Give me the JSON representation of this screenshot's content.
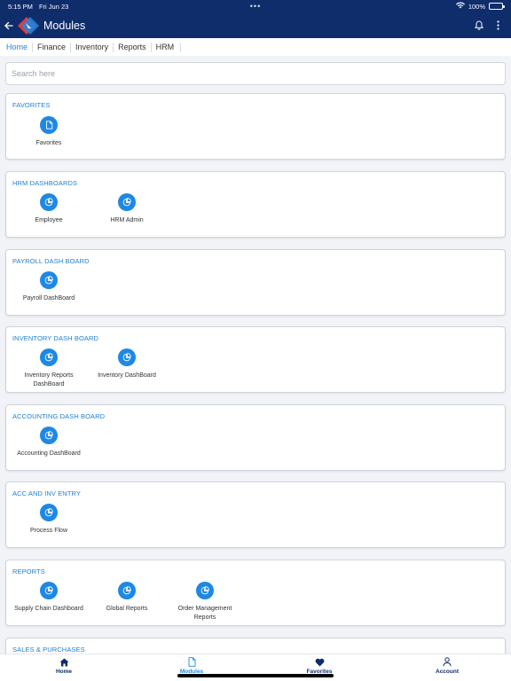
{
  "status": {
    "time": "5:15 PM",
    "date": "Fri Jun 23",
    "dots": "•••",
    "battery": "100%"
  },
  "header": {
    "title": "Modules"
  },
  "tabs": [
    {
      "label": "Home",
      "active": true
    },
    {
      "label": "Finance"
    },
    {
      "label": "Inventory"
    },
    {
      "label": "Reports"
    },
    {
      "label": "HRM"
    }
  ],
  "search": {
    "placeholder": "Search here",
    "value": ""
  },
  "sections": [
    {
      "title": "FAVORITES",
      "items": [
        {
          "label": "Favorites",
          "icon": "document-icon"
        }
      ]
    },
    {
      "title": "HRM DASHBOARDS",
      "items": [
        {
          "label": "Employee",
          "icon": "pie-chart-icon"
        },
        {
          "label": "HRM Admin",
          "icon": "pie-chart-icon"
        }
      ]
    },
    {
      "title": "PAYROLL DASH BOARD",
      "items": [
        {
          "label": "Payroll DashBoard",
          "icon": "pie-chart-icon"
        }
      ]
    },
    {
      "title": "INVENTORY DASH BOARD",
      "items": [
        {
          "label": "Inventory Reports DashBoard",
          "icon": "pie-chart-icon"
        },
        {
          "label": "Inventory DashBoard",
          "icon": "pie-chart-icon"
        }
      ]
    },
    {
      "title": "ACCOUNTING DASH BOARD",
      "items": [
        {
          "label": "Accounting DashBoard",
          "icon": "pie-chart-icon"
        }
      ]
    },
    {
      "title": "ACC AND INV ENTRY",
      "items": [
        {
          "label": "Process Flow",
          "icon": "pie-chart-icon"
        }
      ]
    },
    {
      "title": "REPORTS",
      "items": [
        {
          "label": "Supply Chain Dashboard",
          "icon": "pie-chart-icon"
        },
        {
          "label": "Global Reports",
          "icon": "pie-chart-icon"
        },
        {
          "label": "Order Management Reports",
          "icon": "pie-chart-icon"
        }
      ]
    },
    {
      "title": "SALES & PURCHASES",
      "items": []
    }
  ],
  "bottom_nav": [
    {
      "label": "Home",
      "icon": "home-icon"
    },
    {
      "label": "Modules",
      "icon": "document-icon",
      "active": true
    },
    {
      "label": "Favorites",
      "icon": "heart-icon"
    },
    {
      "label": "Account",
      "icon": "person-icon"
    }
  ],
  "colors": {
    "navy": "#0f2d6b",
    "accent": "#1e88e5",
    "background": "#f1f3f7"
  }
}
